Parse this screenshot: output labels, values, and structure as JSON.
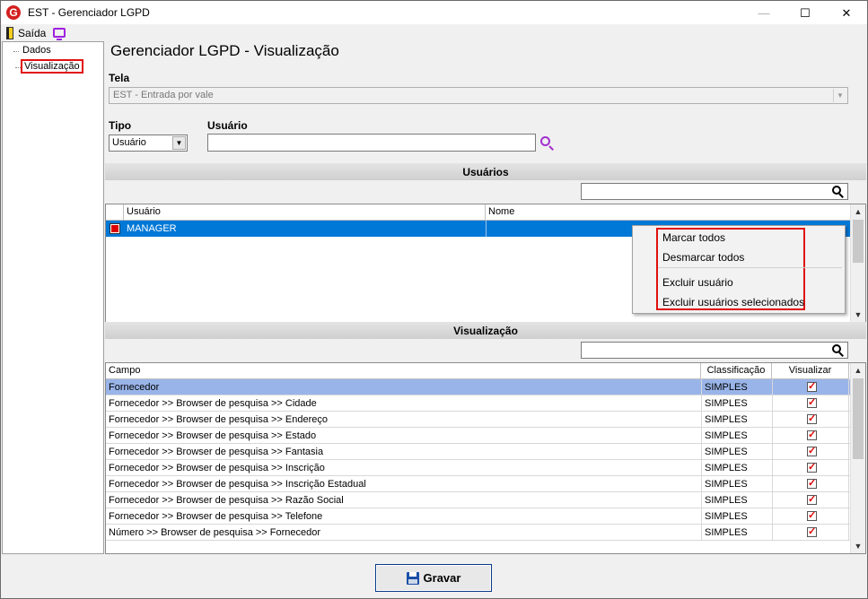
{
  "window": {
    "title": "EST - Gerenciador LGPD",
    "icon_letter": "G",
    "minimize": "—",
    "maximize": "☐",
    "close": "✕"
  },
  "toolbar": {
    "exit_label": "Saída"
  },
  "tree": {
    "items": [
      {
        "label": "Dados"
      },
      {
        "label": "Visualização"
      }
    ]
  },
  "main": {
    "title": "Gerenciador LGPD - Visualização",
    "tela_label": "Tela",
    "tela_value": "EST - Entrada por vale",
    "tipo_label": "Tipo",
    "tipo_value": "Usuário",
    "usuario_label": "Usuário",
    "usuario_value": ""
  },
  "users_section": {
    "title": "Usuários",
    "columns": [
      "Usuário",
      "Nome"
    ],
    "rows": [
      {
        "usuario": "MANAGER",
        "nome": "",
        "checked": true
      }
    ]
  },
  "context_menu": {
    "items": [
      "Marcar todos",
      "Desmarcar todos",
      "Excluir usuário",
      "Excluir usuários selecionados"
    ]
  },
  "vis_section": {
    "title": "Visualização",
    "columns": [
      "Campo",
      "Classificação",
      "Visualizar"
    ],
    "rows": [
      {
        "campo": "Fornecedor",
        "classificacao": "SIMPLES",
        "visualizar": true
      },
      {
        "campo": "Fornecedor >> Browser de pesquisa >> Cidade",
        "classificacao": "SIMPLES",
        "visualizar": true
      },
      {
        "campo": "Fornecedor >> Browser de pesquisa >> Endereço",
        "classificacao": "SIMPLES",
        "visualizar": true
      },
      {
        "campo": "Fornecedor >> Browser de pesquisa >> Estado",
        "classificacao": "SIMPLES",
        "visualizar": true
      },
      {
        "campo": "Fornecedor >> Browser de pesquisa >> Fantasia",
        "classificacao": "SIMPLES",
        "visualizar": true
      },
      {
        "campo": "Fornecedor >> Browser de pesquisa >> Inscrição",
        "classificacao": "SIMPLES",
        "visualizar": true
      },
      {
        "campo": "Fornecedor >> Browser de pesquisa >> Inscrição Estadual",
        "classificacao": "SIMPLES",
        "visualizar": true
      },
      {
        "campo": "Fornecedor >> Browser de pesquisa >> Razão Social",
        "classificacao": "SIMPLES",
        "visualizar": true
      },
      {
        "campo": "Fornecedor >> Browser de pesquisa >> Telefone",
        "classificacao": "SIMPLES",
        "visualizar": true
      },
      {
        "campo": "Número >> Browser de pesquisa >> Fornecedor",
        "classificacao": "SIMPLES",
        "visualizar": true
      }
    ]
  },
  "save_button": {
    "label": "Gravar"
  },
  "colors": {
    "selection": "#0078d7",
    "row_highlight": "#99b4e8",
    "annotation": "#e01010",
    "accent": "#a030d0"
  }
}
